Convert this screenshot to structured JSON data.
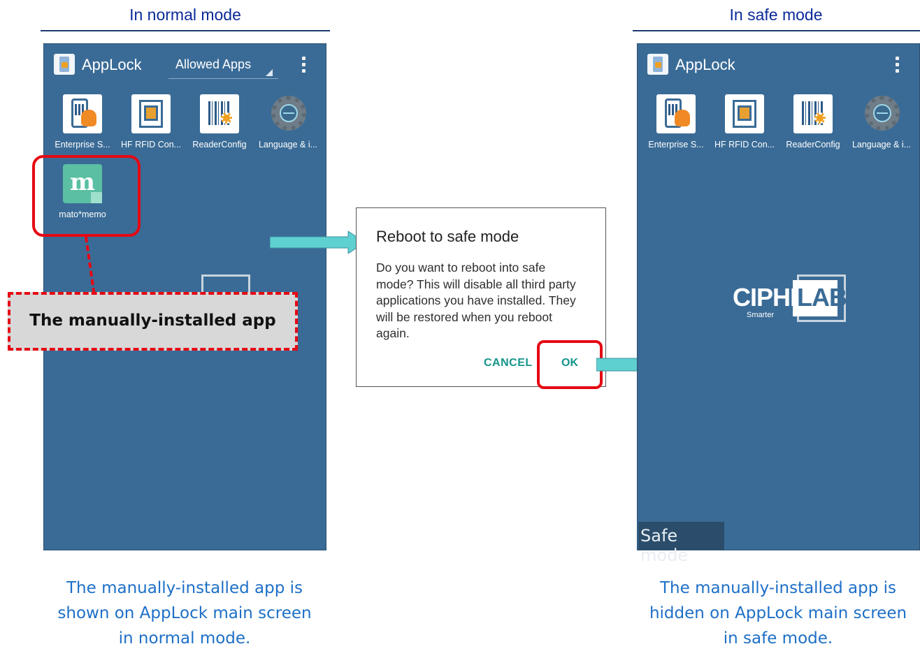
{
  "headings": {
    "left": "In normal mode",
    "right": "In safe mode"
  },
  "normal_screen": {
    "app_title": "AppLock",
    "spinner_value": "Allowed Apps",
    "apps": [
      {
        "label": "Enterprise S...",
        "icon": "enterprise-settings-icon"
      },
      {
        "label": "HF RFID Con...",
        "icon": "rfid-icon"
      },
      {
        "label": "ReaderConfig",
        "icon": "barcode-reader-icon"
      },
      {
        "label": "Language & i...",
        "icon": "language-settings-icon"
      },
      {
        "label": "mato*memo",
        "icon": "mato-memo-icon"
      }
    ]
  },
  "callout": {
    "text": "The manually-installed app"
  },
  "dialog": {
    "title": "Reboot to safe mode",
    "body": "Do you want to reboot into safe mode? This will disable all third party applications you have installed. They will be restored when you reboot again.",
    "cancel_label": "CANCEL",
    "ok_label": "OK"
  },
  "safe_screen": {
    "app_title": "AppLock",
    "apps": [
      {
        "label": "Enterprise S...",
        "icon": "enterprise-settings-icon"
      },
      {
        "label": "HF RFID Con...",
        "icon": "rfid-icon"
      },
      {
        "label": "ReaderConfig",
        "icon": "barcode-reader-icon"
      },
      {
        "label": "Language & i...",
        "icon": "language-settings-icon"
      }
    ],
    "logo_text": "CIPHERLAB",
    "logo_tagline": "Smarter",
    "safe_mode_label": "Safe mode"
  },
  "captions": {
    "left_1": "The manually-installed app is",
    "left_2": "shown on AppLock main screen",
    "left_3": "in normal mode.",
    "right_1": "The manually-installed app is",
    "right_2": "hidden on AppLock main screen",
    "right_3": "in safe mode."
  },
  "colors": {
    "phone_bg": "#3a6b96",
    "highlight": "#e50914",
    "caption": "#1d6fc7",
    "heading": "#0c2a9a",
    "dialog_button": "#14958a",
    "arrow": "#5fd0d0"
  }
}
